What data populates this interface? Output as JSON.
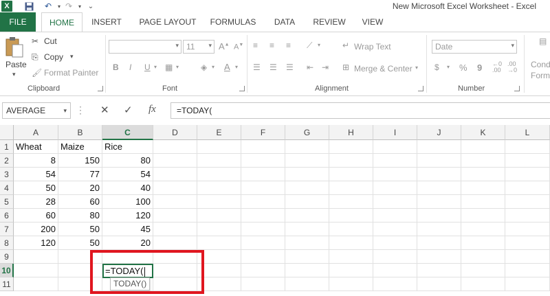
{
  "window": {
    "title": "New Microsoft Excel Worksheet - Excel"
  },
  "quick_access": {
    "icons": [
      "excel-logo",
      "save-icon",
      "undo-icon",
      "redo-icon"
    ]
  },
  "tabs": [
    {
      "label": "FILE"
    },
    {
      "label": "HOME"
    },
    {
      "label": "INSERT"
    },
    {
      "label": "PAGE LAYOUT"
    },
    {
      "label": "FORMULAS"
    },
    {
      "label": "DATA"
    },
    {
      "label": "REVIEW"
    },
    {
      "label": "VIEW"
    }
  ],
  "ribbon": {
    "clipboard": {
      "label": "Clipboard",
      "paste": "Paste",
      "cut": "Cut",
      "copy": "Copy",
      "format_painter": "Format Painter"
    },
    "font": {
      "label": "Font",
      "size": "11",
      "bold": "B",
      "italic": "I",
      "underline": "U"
    },
    "alignment": {
      "label": "Alignment",
      "wrap_text": "Wrap Text",
      "merge_center": "Merge & Center"
    },
    "number": {
      "label": "Number",
      "format": "Date",
      "currency": "$",
      "percent": "%",
      "comma": "9"
    },
    "styles": {
      "cond_line1": "Cond",
      "cond_line2": "Form"
    }
  },
  "formula_bar": {
    "name_box": "AVERAGE",
    "formula": "=TODAY(",
    "cancel": "✕",
    "enter": "✓",
    "fx": "fx"
  },
  "grid": {
    "columns": [
      "A",
      "B",
      "C",
      "D",
      "E",
      "F",
      "G",
      "H",
      "I",
      "J",
      "K",
      "L"
    ],
    "rows": [
      "1",
      "2",
      "3",
      "4",
      "5",
      "6",
      "7",
      "8",
      "9",
      "10",
      "11"
    ],
    "selected_column": "C",
    "selected_row": "10",
    "headers": [
      "Wheat",
      "Maize",
      "Rice"
    ],
    "data": [
      [
        "8",
        "150",
        "80"
      ],
      [
        "54",
        "77",
        "54"
      ],
      [
        "50",
        "20",
        "40"
      ],
      [
        "28",
        "60",
        "100"
      ],
      [
        "60",
        "80",
        "120"
      ],
      [
        "200",
        "50",
        "45"
      ],
      [
        "120",
        "50",
        "20"
      ]
    ],
    "active_cell_value": "=TODAY(",
    "tooltip": "TODAY()"
  },
  "colors": {
    "excel_green": "#217346",
    "highlight_red": "#e0161f"
  }
}
